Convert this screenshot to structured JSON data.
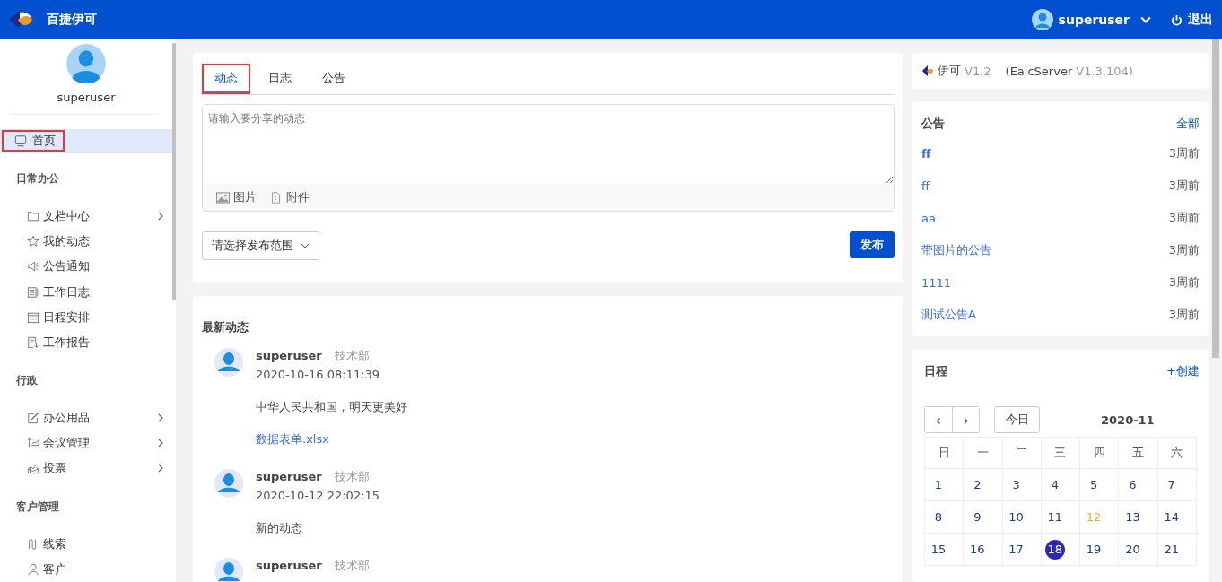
{
  "header": {
    "app_name": "百捷伊可",
    "user": "superuser",
    "logout": "退出"
  },
  "sidebar": {
    "user": "superuser",
    "home": {
      "label": "首页",
      "selected": true,
      "annotated": true
    },
    "groups": [
      {
        "title": "日常办公",
        "items": [
          {
            "label": "文档中心",
            "expandable": true
          },
          {
            "label": "我的动态",
            "expandable": false
          },
          {
            "label": "公告通知",
            "expandable": false
          },
          {
            "label": "工作日志",
            "expandable": false
          },
          {
            "label": "日程安排",
            "expandable": false
          },
          {
            "label": "工作报告",
            "expandable": false
          }
        ]
      },
      {
        "title": "行政",
        "items": [
          {
            "label": "办公用品",
            "expandable": true
          },
          {
            "label": "会议管理",
            "expandable": true
          },
          {
            "label": "投票",
            "expandable": true
          }
        ]
      },
      {
        "title": "客户管理",
        "items": [
          {
            "label": "线索",
            "expandable": false
          },
          {
            "label": "客户",
            "expandable": false
          }
        ]
      }
    ]
  },
  "composer": {
    "tabs": [
      {
        "label": "动态",
        "selected": true,
        "annotated": true
      },
      {
        "label": "日志",
        "selected": false,
        "annotated": false
      },
      {
        "label": "公告",
        "selected": false,
        "annotated": false
      }
    ],
    "placeholder": "请输入要分享的动态",
    "image": "图片",
    "attachment": "附件",
    "scope": "请选择发布范围",
    "publish": "发布"
  },
  "feed": {
    "title": "最新动态",
    "posts": [
      {
        "name": "superuser",
        "dept": "技术部",
        "time": "2020-10-16 08:11:39",
        "text": "中华人民共和国，明天更美好",
        "file": "数据表单.xlsx"
      },
      {
        "name": "superuser",
        "dept": "技术部",
        "time": "2020-10-12 22:02:15",
        "text": "新的动态"
      },
      {
        "name": "superuser",
        "dept": "技术部"
      }
    ]
  },
  "version": {
    "name": "伊可",
    "version": "V1.2",
    "server": "(EaicServer",
    "server_version": "V1.3.104)"
  },
  "notices": {
    "title": "公告",
    "all": "全部",
    "items": [
      {
        "title": "ff",
        "time": "3周前",
        "unread": true
      },
      {
        "title": "ff",
        "time": "3周前",
        "unread": false
      },
      {
        "title": "aa",
        "time": "3周前",
        "unread": false
      },
      {
        "title": "带图片的公告",
        "time": "3周前",
        "unread": false
      },
      {
        "title": "1111",
        "time": "3周前",
        "unread": false
      },
      {
        "title": "测试公告A",
        "time": "3周前",
        "unread": false
      }
    ]
  },
  "schedule": {
    "title": "日程",
    "create": "+创建",
    "prev": "‹",
    "next": "›",
    "today": "今日",
    "month": "2020-11",
    "weekdays": [
      "日",
      "一",
      "二",
      "三",
      "四",
      "五",
      "六"
    ],
    "weeks": [
      [
        {
          "day": "1",
          "kind": "normal"
        },
        {
          "day": "2",
          "kind": "normal"
        },
        {
          "day": "3",
          "kind": "normal"
        },
        {
          "day": "4",
          "kind": "normal"
        },
        {
          "day": "5",
          "kind": "normal"
        },
        {
          "day": "6",
          "kind": "normal"
        },
        {
          "day": "7",
          "kind": "normal"
        }
      ],
      [
        {
          "day": "8",
          "kind": "normal"
        },
        {
          "day": "9",
          "kind": "normal"
        },
        {
          "day": "10",
          "kind": "normal"
        },
        {
          "day": "11",
          "kind": "normal"
        },
        {
          "day": "12",
          "kind": "marked"
        },
        {
          "day": "13",
          "kind": "normal"
        },
        {
          "day": "14",
          "kind": "normal"
        }
      ],
      [
        {
          "day": "15",
          "kind": "normal"
        },
        {
          "day": "16",
          "kind": "normal"
        },
        {
          "day": "17",
          "kind": "normal"
        },
        {
          "day": "18",
          "kind": "today"
        },
        {
          "day": "19",
          "kind": "normal"
        },
        {
          "day": "20",
          "kind": "normal"
        },
        {
          "day": "21",
          "kind": "normal"
        }
      ]
    ]
  }
}
